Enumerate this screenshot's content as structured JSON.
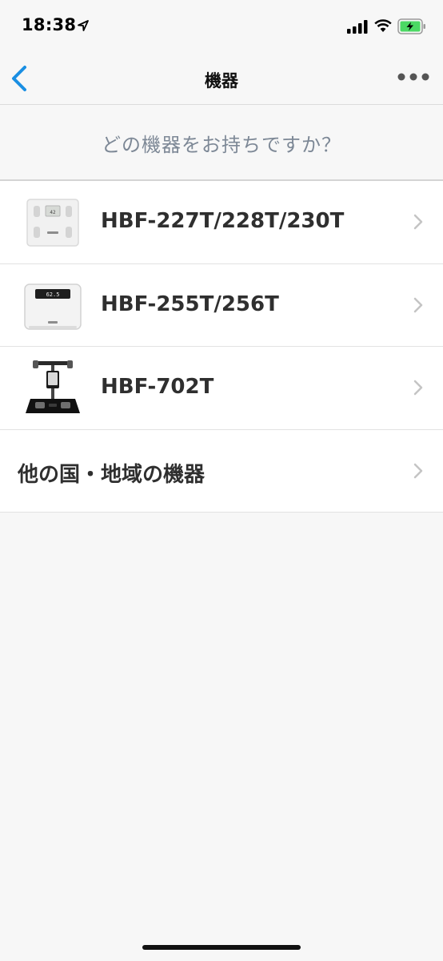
{
  "status_bar": {
    "time": "18:38"
  },
  "nav": {
    "title": "機器"
  },
  "prompt": {
    "text": "どの機器をお持ちですか？"
  },
  "devices": [
    {
      "label": "HBF-227T/228T/230T",
      "thumb_icon": "scale-227t-icon"
    },
    {
      "label": "HBF-255T/256T",
      "thumb_icon": "scale-255t-icon"
    },
    {
      "label": "HBF-702T",
      "thumb_icon": "scale-702t-icon"
    },
    {
      "label": "他の国・地域の機器"
    }
  ],
  "colors": {
    "accent": "#1a8fe3",
    "battery": "#4cd964",
    "prompt_text": "#7d8896"
  }
}
